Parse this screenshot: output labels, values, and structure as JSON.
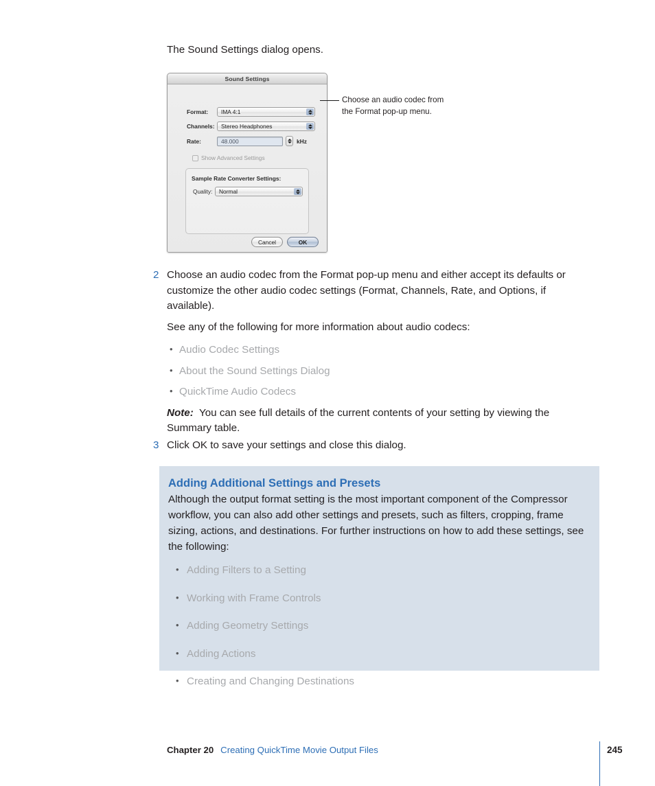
{
  "intro": {
    "text": "The Sound Settings dialog opens."
  },
  "dialog": {
    "title": "Sound Settings",
    "fields": {
      "format_label": "Format:",
      "format_value": "IMA 4:1",
      "channels_label": "Channels:",
      "channels_value": "Stereo Headphones",
      "rate_label": "Rate:",
      "rate_value": "48.000",
      "rate_unit": "kHz",
      "advanced_checkbox_label": "Show Advanced Settings",
      "group_title": "Sample Rate Converter Settings:",
      "quality_label": "Quality:",
      "quality_value": "Normal"
    },
    "buttons": {
      "cancel": "Cancel",
      "ok": "OK"
    }
  },
  "callout": {
    "text": "Choose an audio codec from the Format pop-up menu."
  },
  "steps": [
    {
      "number": "2",
      "paragraphs": [
        "Choose an audio codec from the Format pop-up menu and either accept its defaults or customize the other audio codec settings (Format, Channels, Rate, and Options, if available).",
        "See any of the following for more information about audio codecs:"
      ],
      "links": [
        "Audio Codec Settings",
        "About the Sound Settings Dialog",
        "QuickTime Audio Codecs"
      ],
      "note_label": "Note:",
      "note_text": "You can see full details of the current contents of your setting by viewing the Summary table."
    },
    {
      "number": "3",
      "paragraphs": [
        "Click OK to save your settings and close this dialog."
      ]
    }
  ],
  "bluebox": {
    "title": "Adding Additional Settings and Presets",
    "paragraph": "Although the output format setting is the most important component of the Compressor workflow, you can also add other settings and presets, such as filters, cropping, frame sizing, actions, and destinations. For further instructions on how to add these settings, see the following:",
    "links": [
      "Adding Filters to a Setting",
      "Working with Frame Controls",
      "Adding Geometry Settings",
      "Adding Actions",
      "Creating and Changing Destinations"
    ]
  },
  "footer": {
    "chapter": "Chapter 20",
    "section": "Creating QuickTime Movie Output Files",
    "page_number": "245"
  },
  "colors": {
    "accent_blue": "#2d6eb5",
    "link_gray": "#a7a9ac",
    "bluebox_bg": "#d7e0ea",
    "body_text": "#231f20"
  }
}
